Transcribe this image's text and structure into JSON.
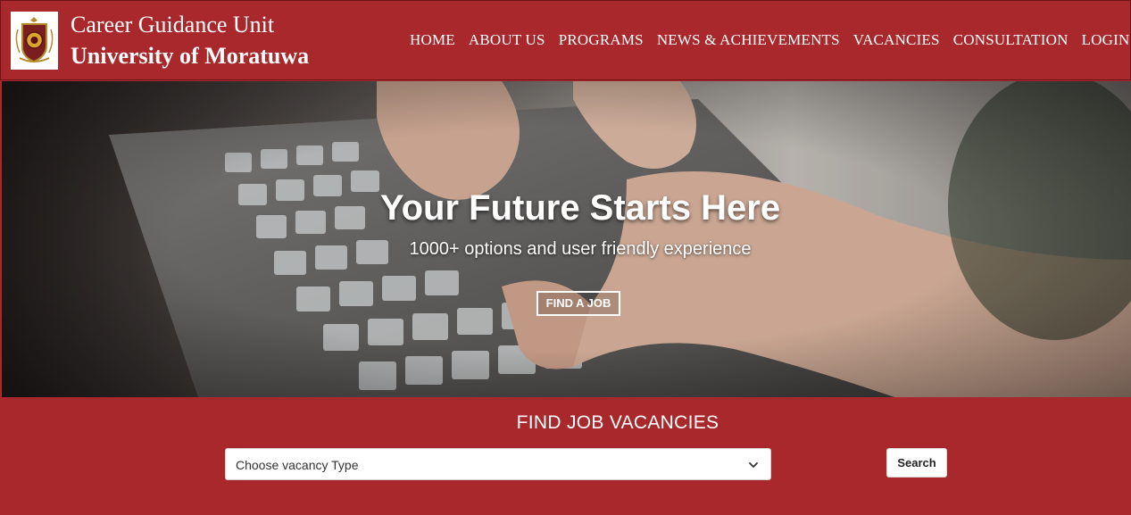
{
  "header": {
    "brand_line1": "Career Guidance Unit",
    "brand_line2": "University of Moratuwa",
    "nav": [
      "HOME",
      "ABOUT US",
      "PROGRAMS",
      "NEWS & ACHIEVEMENTS",
      "VACANCIES",
      "CONSULTATION",
      "LOGIN"
    ]
  },
  "hero": {
    "title": "Your Future Starts Here",
    "subtitle": "1000+ options and user friendly experience",
    "cta_label": "FIND A JOB"
  },
  "vacancies": {
    "title": "FIND JOB VACANCIES",
    "select_value": "Choose vacancy Type",
    "search_label": "Search"
  },
  "colors": {
    "brand_red": "#a8282b",
    "white": "#ffffff"
  },
  "icons": {
    "logo": "university-crest",
    "select": "chevron-down-icon"
  }
}
